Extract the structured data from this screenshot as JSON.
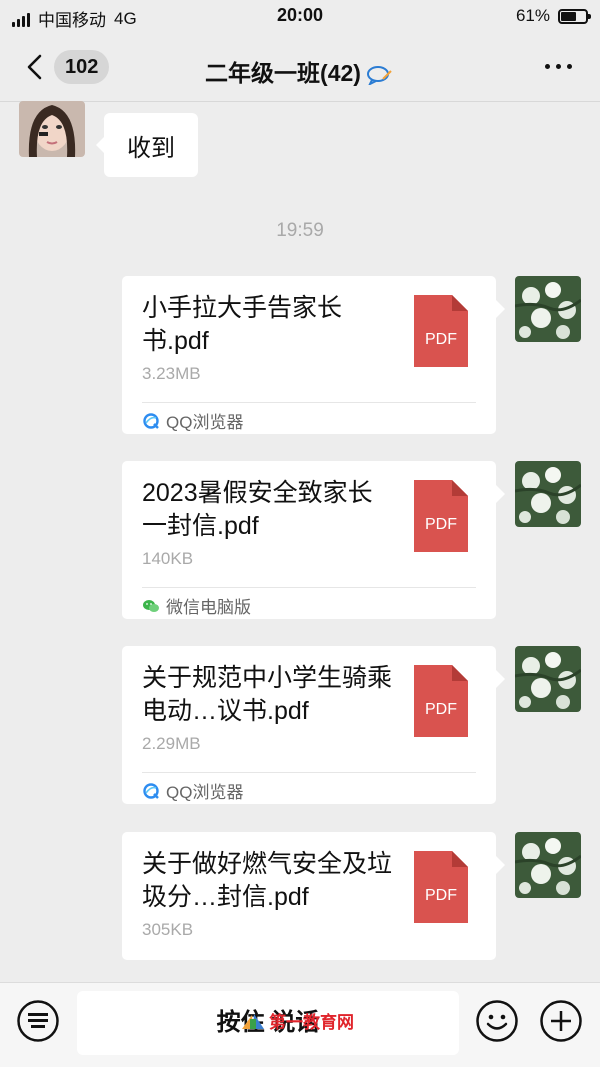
{
  "status_bar": {
    "carrier": "中国移动",
    "network": "4G",
    "time": "20:00",
    "battery_percent": "61%",
    "battery_level": 0.61
  },
  "nav": {
    "back_count": "102",
    "title": "二年级一班(42)",
    "icons": [
      "chevron-left-icon",
      "muted-chat-icon",
      "more-icon"
    ]
  },
  "chat": {
    "incoming": {
      "text": "收到"
    },
    "timestamp": "19:59",
    "files": [
      {
        "name": "小手拉大手告家长书.pdf",
        "size": "3.23MB",
        "type_label": "PDF",
        "source": "QQ浏览器",
        "source_icon": "qq-browser-icon"
      },
      {
        "name": "2023暑假安全致家长一封信.pdf",
        "size": "140KB",
        "type_label": "PDF",
        "source": "微信电脑版",
        "source_icon": "wechat-icon"
      },
      {
        "name": "关于规范中小学生骑乘电动…议书.pdf",
        "size": "2.29MB",
        "type_label": "PDF",
        "source": "QQ浏览器",
        "source_icon": "qq-browser-icon"
      },
      {
        "name": "关于做好燃气安全及垃圾分…封信.pdf",
        "size": "305KB",
        "type_label": "PDF"
      }
    ]
  },
  "bottom_bar": {
    "hold_to_talk": "按住 说话",
    "watermark": "第一教育网",
    "icons": [
      "keyboard-icon",
      "emoji-icon",
      "plus-icon"
    ]
  },
  "colors": {
    "background": "#ededed",
    "pdf_red": "#d9534f",
    "bubble": "#ffffff",
    "muted_text": "#a9a9a9",
    "watermark_red": "#e0242b"
  }
}
